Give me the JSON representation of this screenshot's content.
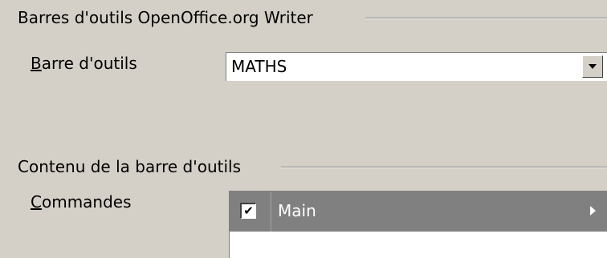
{
  "group1": {
    "title": "Barres d'outils OpenOffice.org Writer",
    "toolbar_label_accel": "B",
    "toolbar_label_rest": "arre d'outils",
    "toolbar_value": "MATHS"
  },
  "group2": {
    "title": "Contenu de la barre d'outils",
    "commands_label_accel": "C",
    "commands_label_rest": "ommandes",
    "commands": [
      {
        "label": "Main",
        "checked": true,
        "selected": true,
        "check_glyph": "✔"
      }
    ]
  },
  "icons": {
    "combo_dropdown": "chevron-down-icon",
    "row_submenu": "chevron-right-icon"
  },
  "colors": {
    "background": "#d4d0c8",
    "selection": "#808080"
  }
}
